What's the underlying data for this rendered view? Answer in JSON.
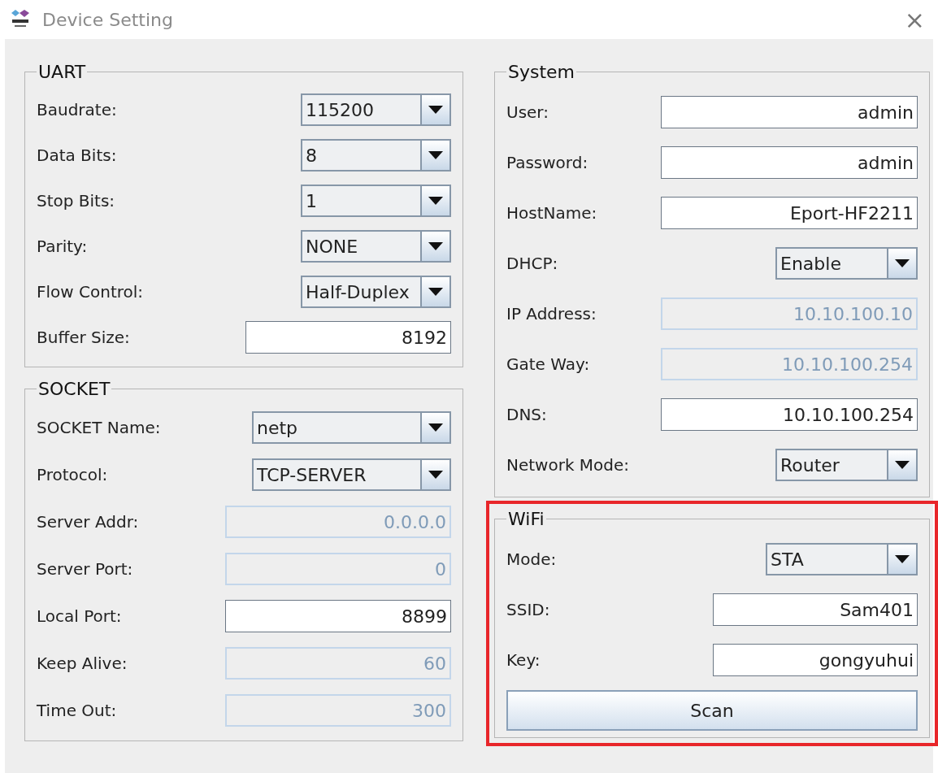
{
  "window": {
    "title": "Device Setting",
    "close": "×"
  },
  "uart": {
    "title": "UART",
    "fields": [
      {
        "label": "Baudrate:",
        "kind": "dropdown",
        "value": "115200",
        "disabled": false
      },
      {
        "label": "Data Bits:",
        "kind": "dropdown",
        "value": "8",
        "disabled": false
      },
      {
        "label": "Stop Bits:",
        "kind": "dropdown",
        "value": "1",
        "disabled": false
      },
      {
        "label": "Parity:",
        "kind": "dropdown",
        "value": "NONE",
        "disabled": false
      },
      {
        "label": "Flow Control:",
        "kind": "dropdown",
        "value": "Half-Duplex",
        "disabled": false
      },
      {
        "label": "Buffer Size:",
        "kind": "text",
        "value": "8192",
        "disabled": false
      }
    ]
  },
  "socket": {
    "title": "SOCKET",
    "fields": [
      {
        "label": "SOCKET Name:",
        "kind": "dropdown",
        "value": "netp",
        "disabled": false
      },
      {
        "label": "Protocol:",
        "kind": "dropdown",
        "value": "TCP-SERVER",
        "disabled": false
      },
      {
        "label": "Server Addr:",
        "kind": "text",
        "value": "0.0.0.0",
        "disabled": true
      },
      {
        "label": "Server Port:",
        "kind": "text",
        "value": "0",
        "disabled": true
      },
      {
        "label": "Local Port:",
        "kind": "text",
        "value": "8899",
        "disabled": false
      },
      {
        "label": "Keep Alive:",
        "kind": "text",
        "value": "60",
        "disabled": true
      },
      {
        "label": "Time Out:",
        "kind": "text",
        "value": "300",
        "disabled": true
      }
    ]
  },
  "system": {
    "title": "System",
    "fields": [
      {
        "label": "User:",
        "kind": "text",
        "value": "admin",
        "disabled": false
      },
      {
        "label": "Password:",
        "kind": "text",
        "value": "admin",
        "disabled": false
      },
      {
        "label": "HostName:",
        "kind": "text",
        "value": "Eport-HF2211",
        "disabled": false
      },
      {
        "label": "DHCP:",
        "kind": "dropdown",
        "value": "Enable",
        "disabled": false
      },
      {
        "label": "IP Address:",
        "kind": "text",
        "value": "10.10.100.10",
        "disabled": true
      },
      {
        "label": "Gate Way:",
        "kind": "text",
        "value": "10.10.100.254",
        "disabled": true
      },
      {
        "label": "DNS:",
        "kind": "text",
        "value": "10.10.100.254",
        "disabled": false
      },
      {
        "label": "Network Mode:",
        "kind": "dropdown",
        "value": "Router",
        "disabled": false
      }
    ]
  },
  "wifi": {
    "title": "WiFi",
    "highlighted": true,
    "fields": [
      {
        "label": "Mode:",
        "kind": "dropdown",
        "value": "STA",
        "disabled": false
      },
      {
        "label": "SSID:",
        "kind": "text",
        "value": "Sam401",
        "disabled": false
      },
      {
        "label": "Key:",
        "kind": "text",
        "value": "gongyuhui",
        "disabled": false
      }
    ],
    "scan_button": "Scan"
  }
}
